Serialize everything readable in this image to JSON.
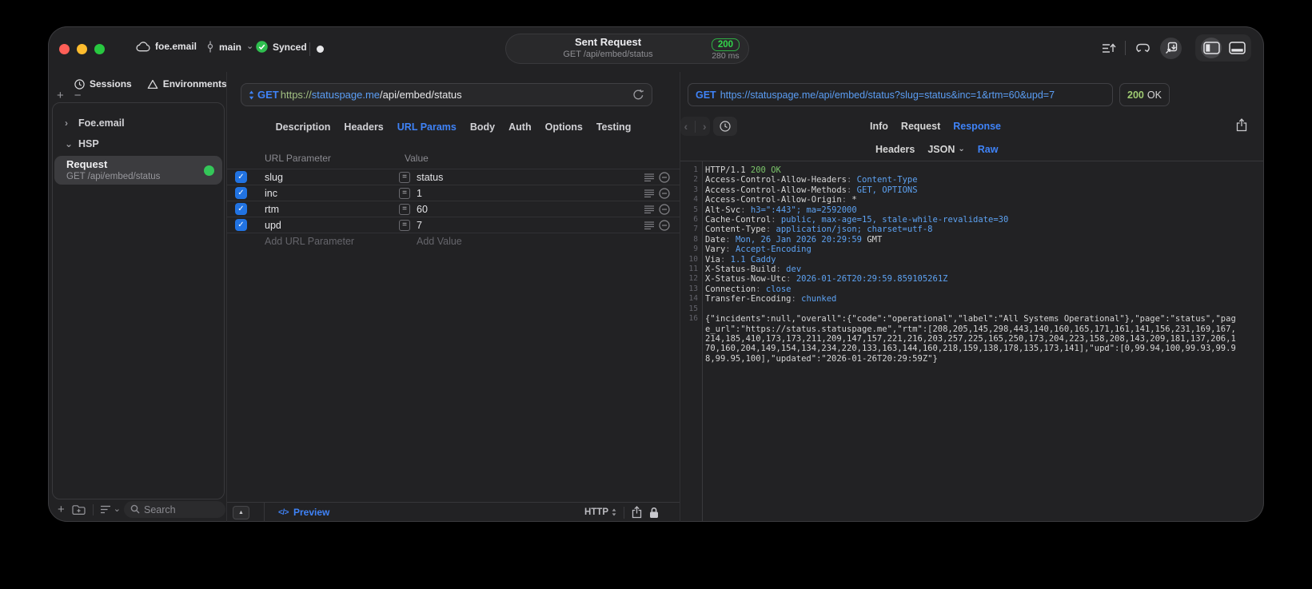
{
  "titlebar": {
    "project": "foe.email",
    "branch": "main",
    "sync_status": "Synced",
    "request_summary": {
      "title": "Sent Request",
      "method_path": "GET /api/embed/status",
      "status_code": "200",
      "duration": "280 ms"
    }
  },
  "sidebar": {
    "tabs": [
      {
        "label": "Sessions"
      },
      {
        "label": "Environments"
      }
    ],
    "tree": [
      {
        "label": "Foe.email",
        "state": "collapsed"
      },
      {
        "label": "HSP",
        "state": "expanded"
      }
    ],
    "request_item": {
      "name": "Request",
      "summary": "GET /api/embed/status"
    },
    "search_placeholder": "Search"
  },
  "request_editor": {
    "method": "GET",
    "url": {
      "scheme": "https://",
      "host": "statuspage.me",
      "path": "/api/embed/status"
    },
    "tabs": [
      {
        "label": "Description",
        "active": false
      },
      {
        "label": "Headers",
        "active": false
      },
      {
        "label": "URL Params",
        "active": true
      },
      {
        "label": "Body",
        "active": false
      },
      {
        "label": "Auth",
        "active": false
      },
      {
        "label": "Options",
        "active": false
      },
      {
        "label": "Testing",
        "active": false
      }
    ],
    "params": {
      "columns": [
        "URL Parameter",
        "Value"
      ],
      "rows": [
        {
          "name": "slug",
          "value": "status",
          "enabled": true
        },
        {
          "name": "inc",
          "value": "1",
          "enabled": true
        },
        {
          "name": "rtm",
          "value": "60",
          "enabled": true
        },
        {
          "name": "upd",
          "value": "7",
          "enabled": true
        }
      ],
      "add_name_placeholder": "Add URL Parameter",
      "add_value_placeholder": "Add Value"
    },
    "footer": {
      "preview_label": "Preview",
      "protocol": "HTTP"
    }
  },
  "response_viewer": {
    "request_line": {
      "method": "GET",
      "url": "https://statuspage.me/api/embed/status?slug=status&inc=1&rtm=60&upd=7"
    },
    "status": {
      "code": "200",
      "text": "OK"
    },
    "tabs": [
      {
        "label": "Info",
        "active": false
      },
      {
        "label": "Request",
        "active": false
      },
      {
        "label": "Response",
        "active": true
      }
    ],
    "subtabs": [
      {
        "label": "Headers",
        "active": false,
        "dropdown": false
      },
      {
        "label": "JSON",
        "active": false,
        "dropdown": true
      },
      {
        "label": "Raw",
        "active": true,
        "dropdown": false
      }
    ],
    "body_lines": [
      {
        "num": 1,
        "segments": [
          {
            "t": "HTTP/1.1 ",
            "c": "plain"
          },
          {
            "t": "200 OK",
            "c": "green"
          }
        ]
      },
      {
        "num": 2,
        "segments": [
          {
            "t": "Access-Control-Allow-Headers",
            "c": "plain"
          },
          {
            "t": ": ",
            "c": "gray"
          },
          {
            "t": "Content-Type",
            "c": "blue"
          }
        ]
      },
      {
        "num": 3,
        "segments": [
          {
            "t": "Access-Control-Allow-Methods",
            "c": "plain"
          },
          {
            "t": ": ",
            "c": "gray"
          },
          {
            "t": "GET, OPTIONS",
            "c": "blue"
          }
        ]
      },
      {
        "num": 4,
        "segments": [
          {
            "t": "Access-Control-Allow-Origin",
            "c": "plain"
          },
          {
            "t": ": ",
            "c": "gray"
          },
          {
            "t": "*",
            "c": "plain"
          }
        ]
      },
      {
        "num": 5,
        "segments": [
          {
            "t": "Alt-Svc",
            "c": "plain"
          },
          {
            "t": ": ",
            "c": "gray"
          },
          {
            "t": "h3=\":443\"; ma=2592000",
            "c": "blue"
          }
        ]
      },
      {
        "num": 6,
        "segments": [
          {
            "t": "Cache-Control",
            "c": "plain"
          },
          {
            "t": ": ",
            "c": "gray"
          },
          {
            "t": "public, max-age=15, stale-while-revalidate=30",
            "c": "blue"
          }
        ]
      },
      {
        "num": 7,
        "segments": [
          {
            "t": "Content-Type",
            "c": "plain"
          },
          {
            "t": ": ",
            "c": "gray"
          },
          {
            "t": "application/json; charset=utf-8",
            "c": "blue"
          }
        ]
      },
      {
        "num": 8,
        "segments": [
          {
            "t": "Date",
            "c": "plain"
          },
          {
            "t": ": ",
            "c": "gray"
          },
          {
            "t": "Mon, 26 Jan 2026 20:29:59",
            "c": "blue"
          },
          {
            "t": " GMT",
            "c": "plain"
          }
        ]
      },
      {
        "num": 9,
        "segments": [
          {
            "t": "Vary",
            "c": "plain"
          },
          {
            "t": ": ",
            "c": "gray"
          },
          {
            "t": "Accept-Encoding",
            "c": "blue"
          }
        ]
      },
      {
        "num": 10,
        "segments": [
          {
            "t": "Via",
            "c": "plain"
          },
          {
            "t": ": ",
            "c": "gray"
          },
          {
            "t": "1.1 Caddy",
            "c": "blue"
          }
        ]
      },
      {
        "num": 11,
        "segments": [
          {
            "t": "X-Status-Build",
            "c": "plain"
          },
          {
            "t": ": ",
            "c": "gray"
          },
          {
            "t": "dev",
            "c": "blue"
          }
        ]
      },
      {
        "num": 12,
        "segments": [
          {
            "t": "X-Status-Now-Utc",
            "c": "plain"
          },
          {
            "t": ": ",
            "c": "gray"
          },
          {
            "t": "2026-01-26T20:29:59.859105261Z",
            "c": "blue"
          }
        ]
      },
      {
        "num": 13,
        "segments": [
          {
            "t": "Connection",
            "c": "plain"
          },
          {
            "t": ": ",
            "c": "gray"
          },
          {
            "t": "close",
            "c": "blue"
          }
        ]
      },
      {
        "num": 14,
        "segments": [
          {
            "t": "Transfer-Encoding",
            "c": "plain"
          },
          {
            "t": ": ",
            "c": "gray"
          },
          {
            "t": "chunked",
            "c": "blue"
          }
        ]
      },
      {
        "num": 15,
        "segments": []
      },
      {
        "num": 16,
        "segments": [
          {
            "t": "{\"incidents\":null,\"overall\":{\"code\":\"operational\",\"label\":\"All Systems Operational\"},\"page\":\"status\",\"page_url\":\"https://status.statuspage.me\",\"rtm\":[208,205,145,298,443,140,160,165,171,161,141,156,231,169,167,214,185,410,173,173,211,209,147,157,221,216,203,257,225,165,250,173,204,223,158,208,143,209,181,137,206,170,160,204,149,154,134,234,220,133,163,144,160,218,159,138,178,135,173,141],\"upd\":[0,99.94,100,99.93,99.98,99.95,100],\"updated\":\"2026-01-26T20:29:59Z\"}",
            "c": "plain"
          }
        ]
      }
    ]
  },
  "icons": {
    "chevron_right": "›",
    "chevron_down": "⌄",
    "plus": "+",
    "minus": "−",
    "triangle_up": "▲",
    "code_tag": "</>",
    "back_chevron": "‹",
    "forward_chevron": "›",
    "check": "✓"
  },
  "colors": {
    "accent_blue": "#3f83f8",
    "url_blue": "#5b9ef5",
    "scheme_green": "#a3c183",
    "badge_green": "#32d74b",
    "ok_green": "#9fcb72",
    "response_value_blue": "#5da2f2",
    "response_green": "#7bc46a",
    "checkbox_blue": "#2173e2"
  }
}
